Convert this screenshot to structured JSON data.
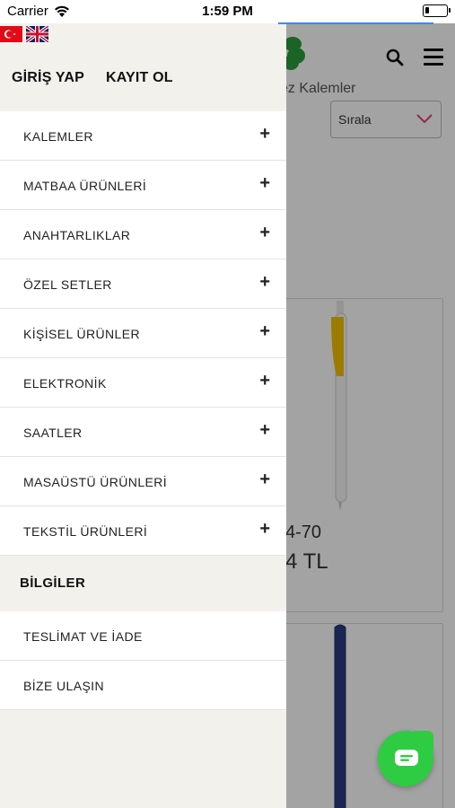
{
  "status_bar": {
    "carrier": "Carrier",
    "time": "1:59 PM",
    "battery_level": 0.2
  },
  "background": {
    "category_title": "ez Kalemler",
    "sort_label": "Sırala",
    "product_code": "4-70",
    "product_price": "4 TL"
  },
  "drawer": {
    "languages": [
      "tr-flag",
      "uk-flag"
    ],
    "login_label": "GİRİŞ YAP",
    "register_label": "KAYIT OL",
    "categories": [
      {
        "label": "KALEMLER"
      },
      {
        "label": "MATBAA ÜRÜNLERİ"
      },
      {
        "label": "ANAHTARLIKLAR"
      },
      {
        "label": "ÖZEL SETLER"
      },
      {
        "label": "KİŞİSEL ÜRÜNLER"
      },
      {
        "label": "ELEKTRONİK"
      },
      {
        "label": "SAATLER"
      },
      {
        "label": "MASAÜSTÜ ÜRÜNLERİ"
      },
      {
        "label": "TEKSTİL ÜRÜNLERİ"
      }
    ],
    "expand_symbol": "+",
    "info_section_title": "BİLGİLER",
    "info_links": [
      {
        "label": "TESLİMAT VE İADE"
      },
      {
        "label": "BİZE ULAŞIN"
      }
    ]
  },
  "colors": {
    "drawer_bg": "#f3f1ec",
    "chat_green": "#2ecc43",
    "accent_blue": "#3b8de0",
    "sort_chevron": "#e0457b"
  }
}
